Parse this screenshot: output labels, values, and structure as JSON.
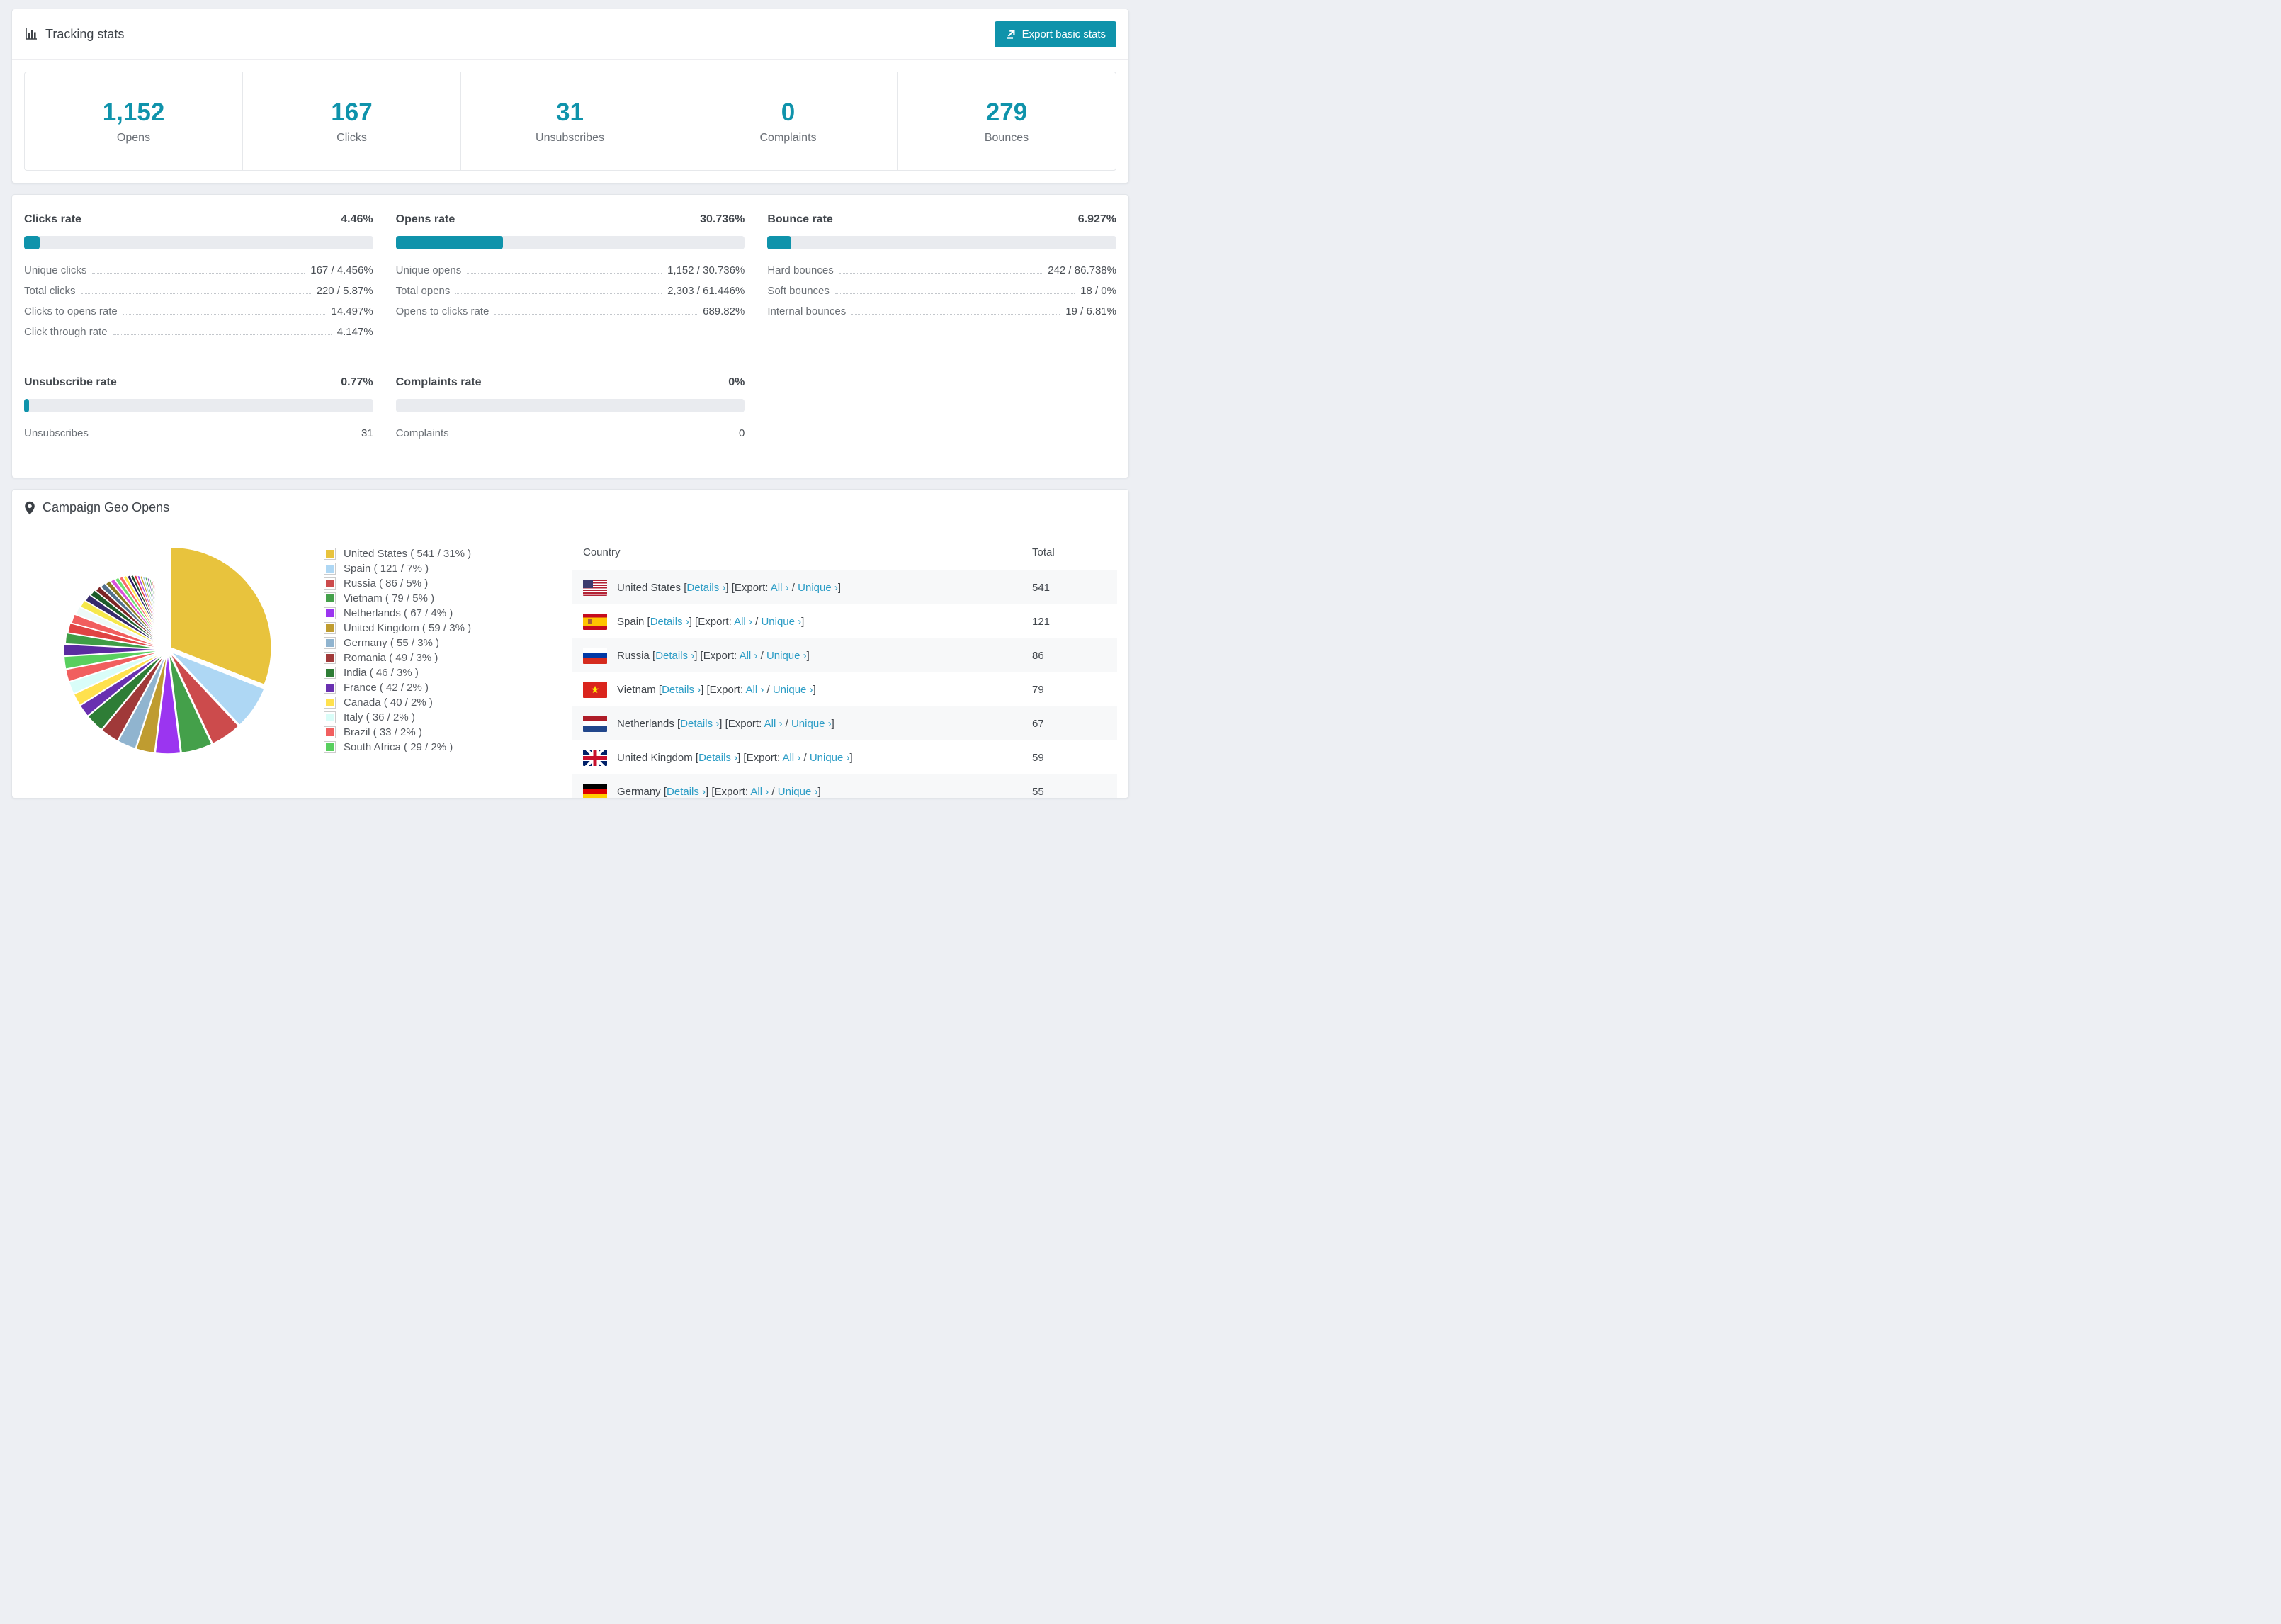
{
  "colors": {
    "accent": "#0f93ab",
    "link": "#2d9dc6",
    "bar_track": "#e9ebef"
  },
  "icons": {
    "header": "bar-chart-icon",
    "export": "export-upload-icon",
    "geo": "map-pin-icon"
  },
  "header": {
    "title": "Tracking stats",
    "export_label": "Export basic stats"
  },
  "summary_stats": [
    {
      "value": "1,152",
      "label": "Opens"
    },
    {
      "value": "167",
      "label": "Clicks"
    },
    {
      "value": "31",
      "label": "Unsubscribes"
    },
    {
      "value": "0",
      "label": "Complaints"
    },
    {
      "value": "279",
      "label": "Bounces"
    }
  ],
  "rate_blocks": [
    {
      "title": "Clicks rate",
      "value": "4.46%",
      "pct": 4.46,
      "rows": [
        [
          "Unique clicks",
          "167 / 4.456%"
        ],
        [
          "Total clicks",
          "220 / 5.87%"
        ],
        [
          "Clicks to opens rate",
          "14.497%"
        ],
        [
          "Click through rate",
          "4.147%"
        ]
      ]
    },
    {
      "title": "Opens rate",
      "value": "30.736%",
      "pct": 30.736,
      "rows": [
        [
          "Unique opens",
          "1,152 / 30.736%"
        ],
        [
          "Total opens",
          "2,303 / 61.446%"
        ],
        [
          "Opens to clicks rate",
          "689.82%"
        ]
      ]
    },
    {
      "title": "Bounce rate",
      "value": "6.927%",
      "pct": 6.927,
      "rows": [
        [
          "Hard bounces",
          "242 / 86.738%"
        ],
        [
          "Soft bounces",
          "18 / 0%"
        ],
        [
          "Internal bounces",
          "19 / 6.81%"
        ]
      ]
    },
    {
      "title": "Unsubscribe rate",
      "value": "0.77%",
      "pct": 0.77,
      "rows": [
        [
          "Unsubscribes",
          "31"
        ]
      ]
    },
    {
      "title": "Complaints rate",
      "value": "0%",
      "pct": 0,
      "rows": [
        [
          "Complaints",
          "0"
        ]
      ]
    }
  ],
  "geo": {
    "title": "Campaign Geo Opens",
    "legend_glue": {
      "open": " ( ",
      "mid": " / ",
      "close": "% )"
    },
    "chart_data": {
      "type": "pie",
      "title": "Campaign Geo Opens",
      "unit": "opens",
      "start_angle_deg": 0,
      "direction": "clockwise",
      "slices": [
        {
          "name": "United States",
          "count": 541,
          "pct": 31,
          "color": "#e8c33d"
        },
        {
          "name": "Spain",
          "count": 121,
          "pct": 7,
          "color": "#aed7f4"
        },
        {
          "name": "Russia",
          "count": 86,
          "pct": 5,
          "color": "#cc4b4c"
        },
        {
          "name": "Vietnam",
          "count": 79,
          "pct": 5,
          "color": "#44a04a"
        },
        {
          "name": "Netherlands",
          "count": 67,
          "pct": 4,
          "color": "#9b35f0"
        },
        {
          "name": "United Kingdom",
          "count": 59,
          "pct": 3,
          "color": "#bf9c30"
        },
        {
          "name": "Germany",
          "count": 55,
          "pct": 3,
          "color": "#90b4cf"
        },
        {
          "name": "Romania",
          "count": 49,
          "pct": 3,
          "color": "#a03939"
        },
        {
          "name": "India",
          "count": 46,
          "pct": 3,
          "color": "#2e7d36"
        },
        {
          "name": "France",
          "count": 42,
          "pct": 2,
          "color": "#6930b0"
        },
        {
          "name": "Canada",
          "count": 40,
          "pct": 2,
          "color": "#ffe14e"
        },
        {
          "name": "Italy",
          "count": 36,
          "pct": 2,
          "color": "#d9fdf8"
        },
        {
          "name": "Brazil",
          "count": 33,
          "pct": 2,
          "color": "#f15f5f"
        },
        {
          "name": "South Africa",
          "count": 29,
          "pct": 2,
          "color": "#58cf5e"
        }
      ],
      "others": {
        "total_pct": 26,
        "count": 46,
        "palette": [
          "#5a2ca0",
          "#3f9d46",
          "#e04343",
          "#f15e5e",
          "#eef9f7",
          "#f6e84b",
          "#352a6b",
          "#1d5c2a",
          "#7c2626",
          "#51708c",
          "#8a7a1e",
          "#d94fd9",
          "#6fe06f",
          "#fa6a6a",
          "#ffee4d",
          "#2d1b66",
          "#1d4d28",
          "#e03535",
          "#a64ced",
          "#c9a42a",
          "#9cc7e8",
          "#44a04a"
        ]
      }
    },
    "table": {
      "columns": [
        "Country",
        "Total"
      ],
      "link_labels": {
        "details": "Details ›",
        "all": "All ›",
        "unique": "Unique ›"
      },
      "glue": {
        "before_details": " [",
        "after_details": "] [Export: ",
        "between": " / ",
        "after": "]"
      },
      "rows": [
        {
          "flag": "us",
          "country": "United States",
          "total": "541"
        },
        {
          "flag": "es",
          "country": "Spain",
          "total": "121"
        },
        {
          "flag": "ru",
          "country": "Russia",
          "total": "86"
        },
        {
          "flag": "vn",
          "country": "Vietnam",
          "total": "79"
        },
        {
          "flag": "nl",
          "country": "Netherlands",
          "total": "67"
        },
        {
          "flag": "gb",
          "country": "United Kingdom",
          "total": "59"
        },
        {
          "flag": "de",
          "country": "Germany",
          "total": "55"
        }
      ]
    }
  }
}
